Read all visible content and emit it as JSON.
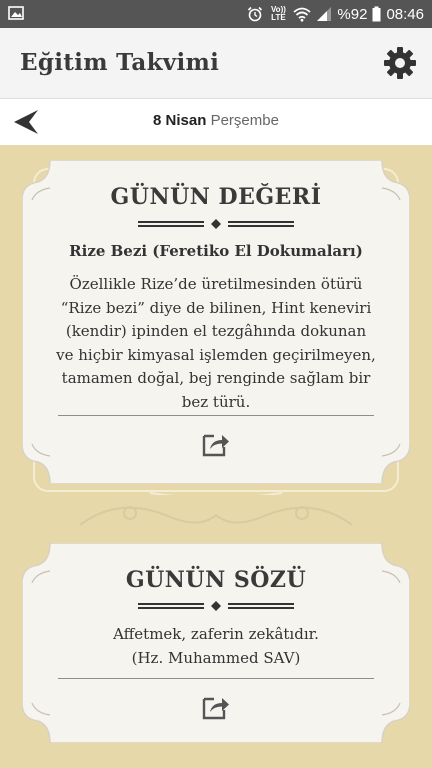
{
  "status_bar": {
    "network_label": "Vo)) LTE",
    "battery_text": "%92",
    "time": "08:46"
  },
  "app_bar": {
    "title": "Eğitim Takvimi",
    "settings_icon": "gear-icon"
  },
  "date_bar": {
    "back_icon": "back-arrow-icon",
    "day": "8 Nisan",
    "weekday": "Perşembe"
  },
  "cards": {
    "value_of_day": {
      "title": "GÜNÜN DEĞERİ",
      "subtitle": "Rize Bezi (Feretiko El Dokumaları)",
      "body_lines": [
        "Özellikle Rize’de üretilmesinden ötürü",
        "“Rize bezi” diye de bilinen, Hint keneviri",
        "(kendir) ipinden el tezgâhında dokunan",
        "ve hiçbir kimyasal işlemden geçirilmeyen,",
        "tamamen doğal, bej renginde sağlam bir",
        "bez türü."
      ],
      "share_icon": "share-icon"
    },
    "quote_of_day": {
      "title": "GÜNÜN SÖZÜ",
      "body_lines": [
        "Affetmek, zaferin zekâtıdır.",
        "(Hz. Muhammed SAV)"
      ],
      "share_icon": "share-icon"
    }
  },
  "colors": {
    "status_bar": "#555555",
    "app_bar": "#f4f4f4",
    "background": "#e6d8a8",
    "card": "#f6f4ef",
    "text": "#333333"
  }
}
